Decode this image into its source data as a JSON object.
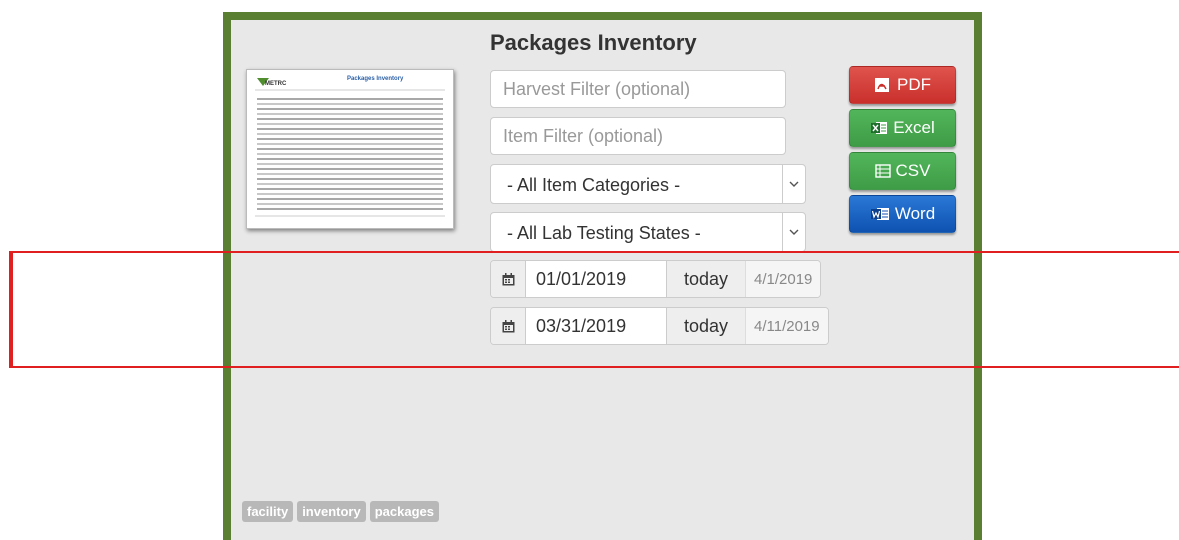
{
  "page": {
    "title": "Packages Inventory"
  },
  "filters": {
    "harvest_placeholder": "Harvest Filter (optional)",
    "item_placeholder": "Item Filter (optional)",
    "category_selected": "- All Item Categories -",
    "lab_state_selected": "- All Lab Testing States -"
  },
  "dates": {
    "start": {
      "value": "01/01/2019",
      "today_label": "today",
      "hint": "4/1/2019"
    },
    "end": {
      "value": "03/31/2019",
      "today_label": "today",
      "hint": "4/11/2019"
    }
  },
  "export": {
    "pdf_label": "PDF",
    "excel_label": "Excel",
    "csv_label": "CSV",
    "word_label": "Word"
  },
  "thumbnail": {
    "logo_text": "METRC",
    "report_title": "Packages Inventory"
  },
  "tags": [
    "facility",
    "inventory",
    "packages"
  ],
  "colors": {
    "panel_border": "#5a7f32",
    "pdf": "#d9534f",
    "excel": "#47a84f",
    "csv": "#47a84f",
    "word": "#1a5fc2",
    "highlight": "#e02020"
  }
}
